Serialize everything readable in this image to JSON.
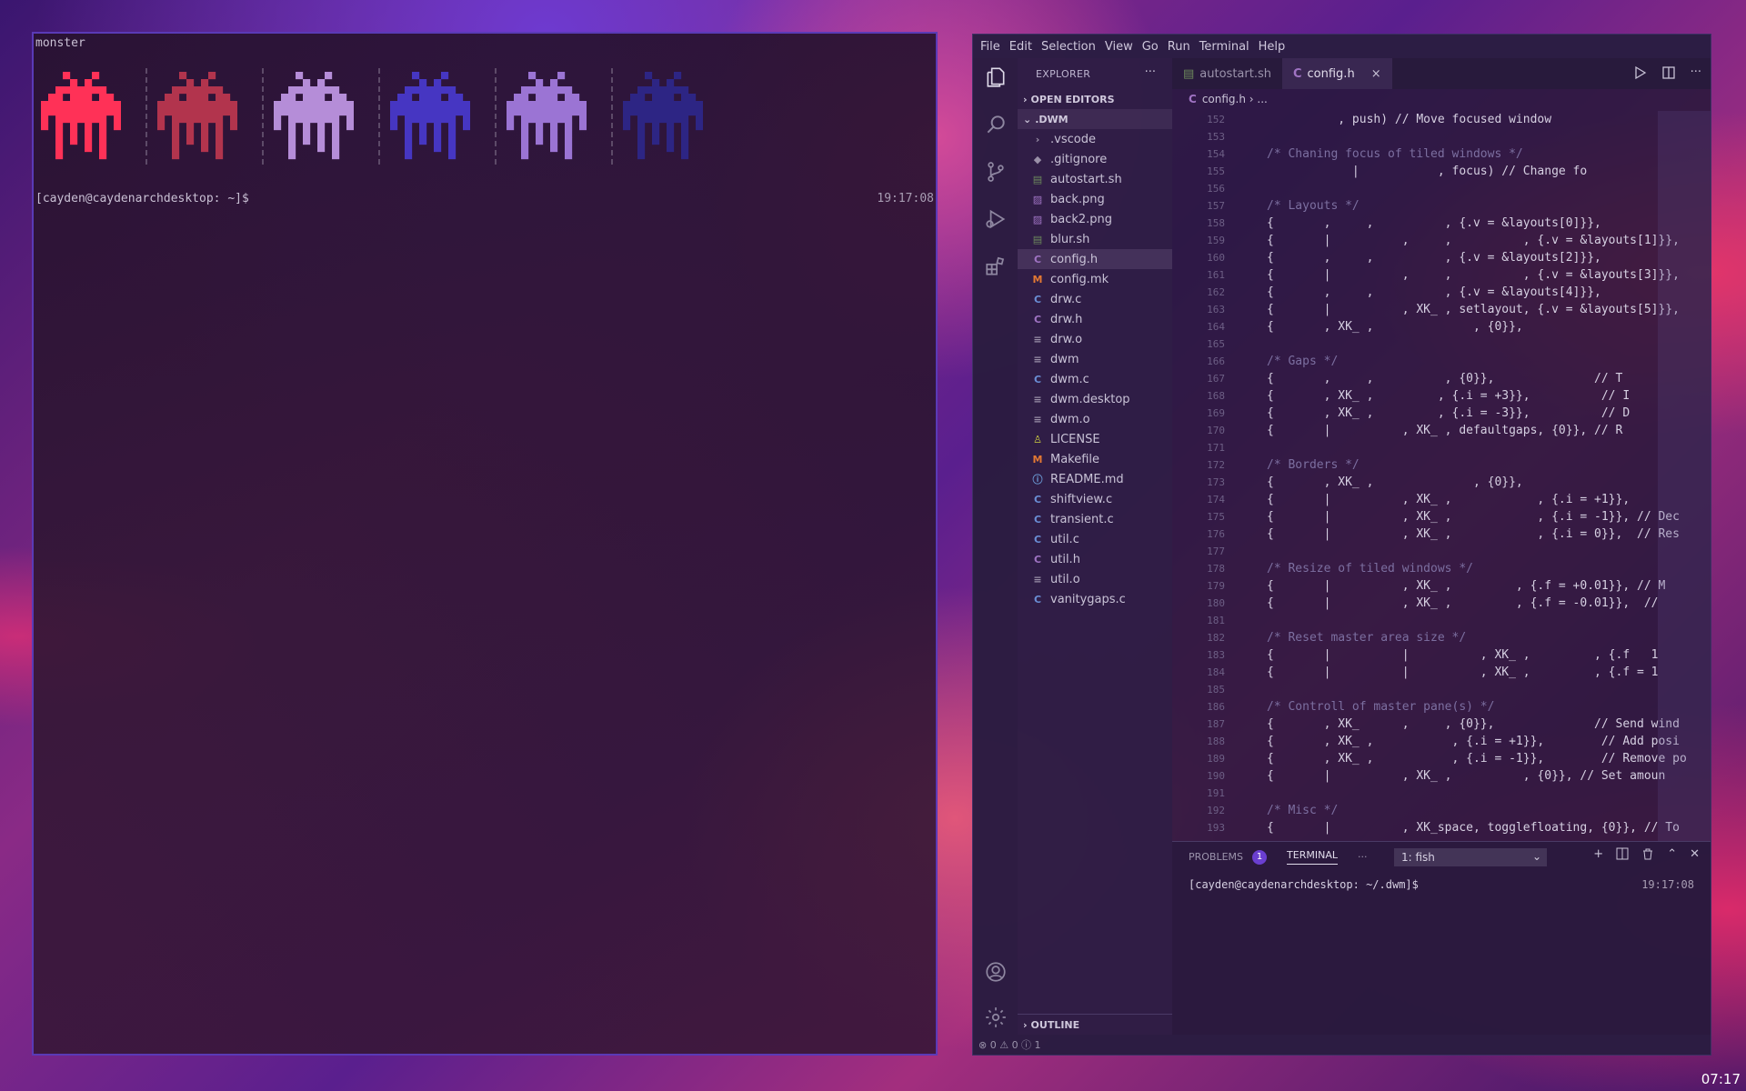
{
  "terminal": {
    "title": "monster",
    "prompt": "[cayden@caydenarchdesktop: ~]$",
    "clock": "19:17:08",
    "sprite_colors": [
      "#ff3157",
      "#b2344d",
      "#b58dd8",
      "#4636c2",
      "#9b74d4",
      "#2d2584"
    ]
  },
  "vscode": {
    "menu": [
      "File",
      "Edit",
      "Selection",
      "View",
      "Go",
      "Run",
      "Terminal",
      "Help"
    ],
    "explorer_title": "EXPLORER",
    "open_editors": "OPEN EDITORS",
    "folder": ".DWM",
    "files": [
      {
        "name": ".vscode",
        "icon": "folder"
      },
      {
        "name": ".gitignore",
        "icon": "git"
      },
      {
        "name": "autostart.sh",
        "icon": "shell"
      },
      {
        "name": "back.png",
        "icon": "image"
      },
      {
        "name": "back2.png",
        "icon": "image"
      },
      {
        "name": "blur.sh",
        "icon": "shell"
      },
      {
        "name": "config.h",
        "icon": "h"
      },
      {
        "name": "config.mk",
        "icon": "m"
      },
      {
        "name": "drw.c",
        "icon": "c"
      },
      {
        "name": "drw.h",
        "icon": "h"
      },
      {
        "name": "drw.o",
        "icon": "text"
      },
      {
        "name": "dwm",
        "icon": "text"
      },
      {
        "name": "dwm.c",
        "icon": "c"
      },
      {
        "name": "dwm.desktop",
        "icon": "text"
      },
      {
        "name": "dwm.o",
        "icon": "text"
      },
      {
        "name": "LICENSE",
        "icon": "license"
      },
      {
        "name": "Makefile",
        "icon": "m"
      },
      {
        "name": "README.md",
        "icon": "info"
      },
      {
        "name": "shiftview.c",
        "icon": "c"
      },
      {
        "name": "transient.c",
        "icon": "c"
      },
      {
        "name": "util.c",
        "icon": "c"
      },
      {
        "name": "util.h",
        "icon": "h"
      },
      {
        "name": "util.o",
        "icon": "text"
      },
      {
        "name": "vanitygaps.c",
        "icon": "c"
      }
    ],
    "outline": "OUTLINE",
    "tabs": [
      {
        "label": "autostart.sh",
        "active": false
      },
      {
        "label": "config.h",
        "active": true
      }
    ],
    "close_glyph": "×",
    "breadcrumb": [
      "config.h",
      "..."
    ],
    "code": [
      {
        "ln": "152",
        "text": "          , push) // Move focused window",
        "type": "code"
      },
      {
        "ln": "153",
        "text": "",
        "type": "code"
      },
      {
        "ln": "154",
        "text": "/* Chaning focus of tiled windows */",
        "type": "comment"
      },
      {
        "ln": "155",
        "text": "            |           , focus) // Change fo",
        "type": "code"
      },
      {
        "ln": "156",
        "text": "",
        "type": "code"
      },
      {
        "ln": "157",
        "text": "/* Layouts */",
        "type": "comment"
      },
      {
        "ln": "158",
        "text": "{       ,     ,          , {.v = &layouts[0]}},",
        "type": "code"
      },
      {
        "ln": "159",
        "text": "{       |          ,     ,          , {.v = &layouts[1]}},",
        "type": "code"
      },
      {
        "ln": "160",
        "text": "{       ,     ,          , {.v = &layouts[2]}},",
        "type": "code"
      },
      {
        "ln": "161",
        "text": "{       |          ,     ,          , {.v = &layouts[3]}},",
        "type": "code"
      },
      {
        "ln": "162",
        "text": "{       ,     ,          , {.v = &layouts[4]}},",
        "type": "code"
      },
      {
        "ln": "163",
        "text": "{       |          , XK_ , setlayout, {.v = &layouts[5]}},",
        "type": "code"
      },
      {
        "ln": "164",
        "text": "{       , XK_ ,              , {0}},",
        "type": "code"
      },
      {
        "ln": "165",
        "text": "",
        "type": "code"
      },
      {
        "ln": "166",
        "text": "/* Gaps */",
        "type": "comment"
      },
      {
        "ln": "167",
        "text": "{       ,     ,          , {0}},              // T",
        "type": "code"
      },
      {
        "ln": "168",
        "text": "{       , XK_ ,         , {.i = +3}},          // I",
        "type": "code"
      },
      {
        "ln": "169",
        "text": "{       , XK_ ,         , {.i = -3}},          // D",
        "type": "code"
      },
      {
        "ln": "170",
        "text": "{       |          , XK_ , defaultgaps, {0}}, // R",
        "type": "code"
      },
      {
        "ln": "171",
        "text": "",
        "type": "code"
      },
      {
        "ln": "172",
        "text": "/* Borders */",
        "type": "comment"
      },
      {
        "ln": "173",
        "text": "{       , XK_ ,              , {0}},",
        "type": "code"
      },
      {
        "ln": "174",
        "text": "{       |          , XK_ ,            , {.i = +1}},",
        "type": "code"
      },
      {
        "ln": "175",
        "text": "{       |          , XK_ ,            , {.i = -1}}, // Dec",
        "type": "code"
      },
      {
        "ln": "176",
        "text": "{       |          , XK_ ,            , {.i = 0}},  // Res",
        "type": "code"
      },
      {
        "ln": "177",
        "text": "",
        "type": "code"
      },
      {
        "ln": "178",
        "text": "/* Resize of tiled windows */",
        "type": "comment"
      },
      {
        "ln": "179",
        "text": "{       |          , XK_ ,         , {.f = +0.01}}, // M",
        "type": "code"
      },
      {
        "ln": "180",
        "text": "{       |          , XK_ ,         , {.f = -0.01}},  //",
        "type": "code"
      },
      {
        "ln": "181",
        "text": "",
        "type": "code"
      },
      {
        "ln": "182",
        "text": "/* Reset master area size */",
        "type": "comment"
      },
      {
        "ln": "183",
        "text": "{       |          |          , XK_ ,         , {.f   1",
        "type": "code"
      },
      {
        "ln": "184",
        "text": "{       |          |          , XK_ ,         , {.f = 1",
        "type": "code"
      },
      {
        "ln": "185",
        "text": "",
        "type": "code"
      },
      {
        "ln": "186",
        "text": "/* Controll of master pane(s) */",
        "type": "comment"
      },
      {
        "ln": "187",
        "text": "{       , XK_      ,     , {0}},              // Send wind",
        "type": "code"
      },
      {
        "ln": "188",
        "text": "{       , XK_ ,           , {.i = +1}},        // Add posi",
        "type": "code"
      },
      {
        "ln": "189",
        "text": "{       , XK_ ,           , {.i = -1}},        // Remove po",
        "type": "code"
      },
      {
        "ln": "190",
        "text": "{       |          , XK_ ,          , {0}}, // Set amoun",
        "type": "code"
      },
      {
        "ln": "191",
        "text": "",
        "type": "code"
      },
      {
        "ln": "192",
        "text": "/* Misc */",
        "type": "comment"
      },
      {
        "ln": "193",
        "text": "{       |          , XK_space, togglefloating, {0}}, // To",
        "type": "code"
      }
    ],
    "panel": {
      "problems": "PROBLEMS",
      "problems_count": "1",
      "terminal": "TERMINAL",
      "more": "···",
      "select": "1: fish",
      "prompt": "[cayden@caydenarchdesktop: ~/.dwm]$",
      "clock": "19:17:08"
    },
    "status": "⊗ 0 ⚠ 0 ⓘ 1"
  },
  "system_clock": "07:17"
}
